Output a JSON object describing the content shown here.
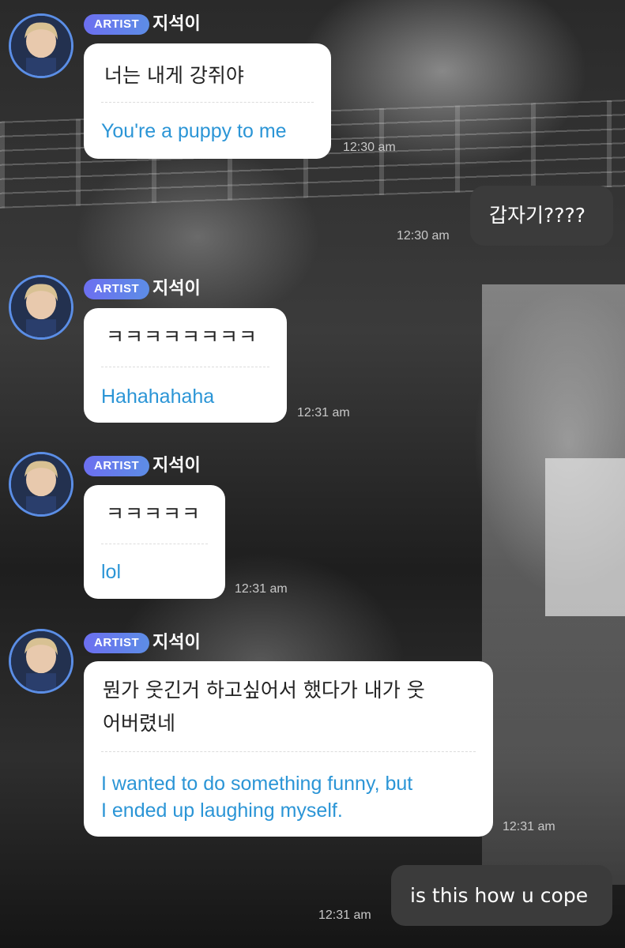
{
  "messages": [
    {
      "badge": "ARTIST",
      "sender": "지석이",
      "original": "너는 내게 강쥐야",
      "translation": "You're a puppy to me",
      "time": "12:30 am"
    },
    {
      "mine": true,
      "text": "갑자기????",
      "time": "12:30 am"
    },
    {
      "badge": "ARTIST",
      "sender": "지석이",
      "original": "ㅋㅋㅋㅋㅋㅋㅋㅋ",
      "translation": "Hahahahaha",
      "time": "12:31 am"
    },
    {
      "badge": "ARTIST",
      "sender": "지석이",
      "original": "ㅋㅋㅋㅋㅋ",
      "translation": "lol",
      "time": "12:31 am"
    },
    {
      "badge": "ARTIST",
      "sender": "지석이",
      "original_lines": [
        "뭔가 웃긴거 하고싶어서 했다가 내가 웃",
        "어버렸네"
      ],
      "translation_lines": [
        "I wanted to do something funny, but",
        "I ended up laughing myself."
      ],
      "time": "12:31 am"
    },
    {
      "mine": true,
      "text": "is this how u cope",
      "time": "12:31 am"
    }
  ],
  "icons": {
    "avatar": "artist-avatar-icon"
  },
  "colors": {
    "badge_start": "#6c6ff0",
    "badge_end": "#5d8de6",
    "translation_text": "#2b95d6",
    "avatar_ring": "#5b8ee6",
    "my_bubble": "#3b3b3b"
  }
}
